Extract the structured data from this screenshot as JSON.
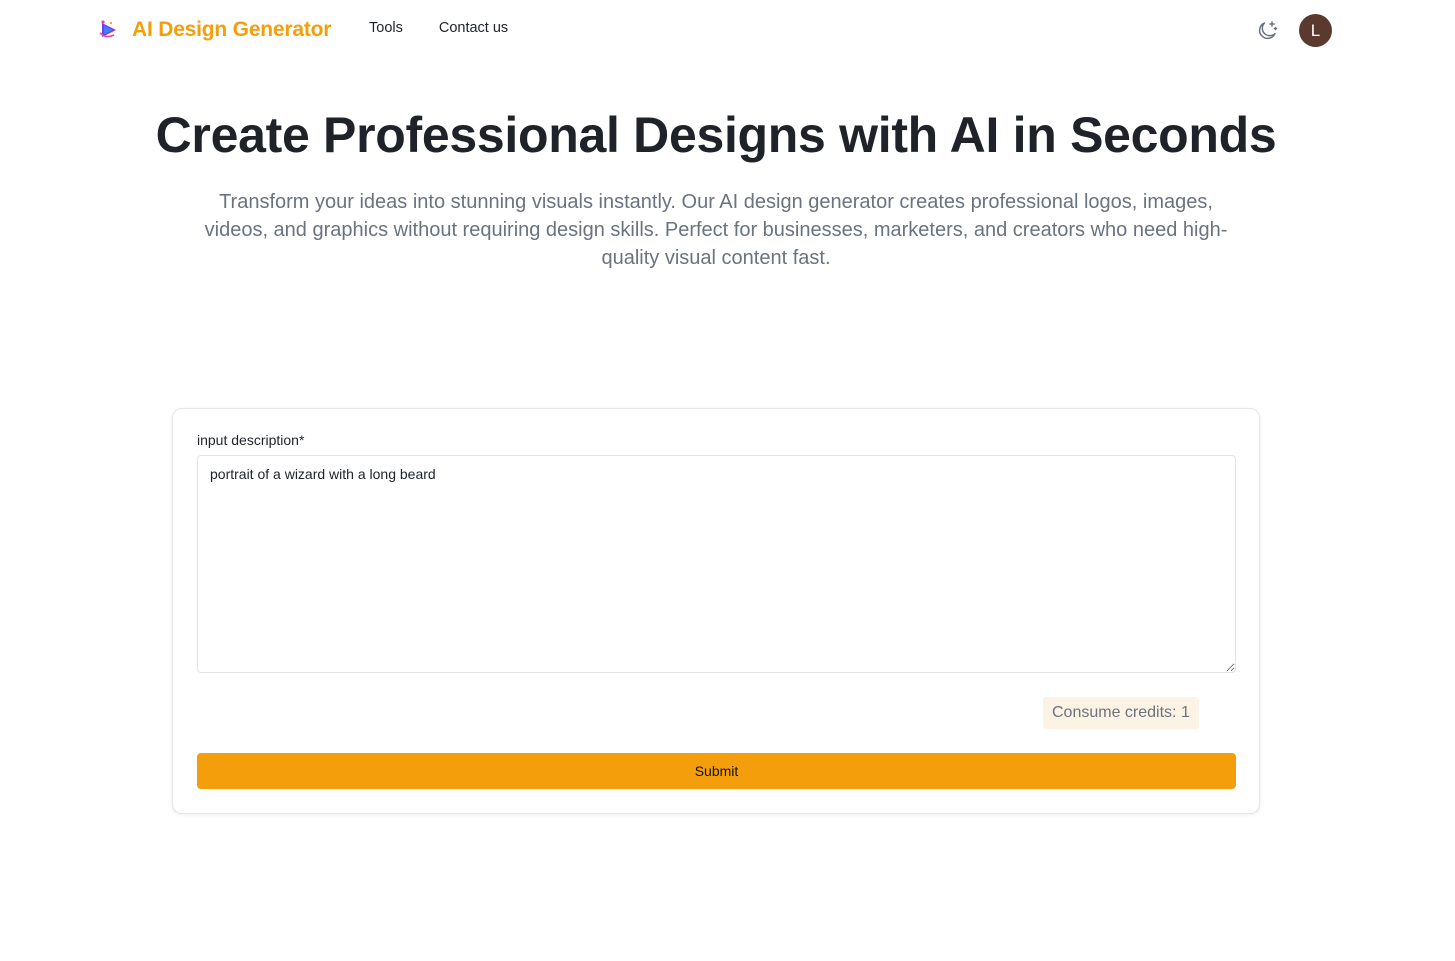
{
  "header": {
    "brand_name": "AI Design Generator",
    "logo_icon": "sparkle-logo-icon",
    "nav": [
      {
        "label": "Tools"
      },
      {
        "label": "Contact us"
      }
    ],
    "theme_toggle_icon": "moon-stars-icon",
    "avatar_initial": "L"
  },
  "hero": {
    "title": "Create Professional Designs with AI in Seconds",
    "subtitle": "Transform your ideas into stunning visuals instantly. Our AI design generator creates professional logos, images, videos, and graphics without requiring design skills. Perfect for businesses, marketers, and creators who need high-quality visual content fast."
  },
  "form": {
    "label": "input description*",
    "description_value": "portrait of a wizard with a long beard",
    "credits_text": "Consume credits: 1",
    "submit_label": "Submit"
  },
  "colors": {
    "accent": "#f59e0b",
    "avatar_bg": "#5a3a2e",
    "credits_bg": "#fdf3e4",
    "muted_text": "#6b7280"
  }
}
